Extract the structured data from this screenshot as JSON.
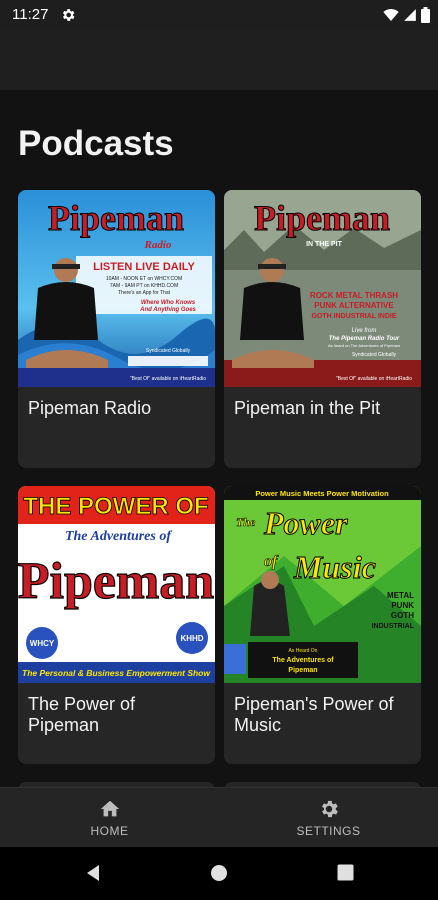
{
  "status_bar": {
    "time": "11:27",
    "icons": [
      "gear-icon",
      "wifi-icon",
      "signal-icon",
      "battery-icon"
    ]
  },
  "page": {
    "title": "Podcasts"
  },
  "podcasts": [
    {
      "title": "Pipeman Radio",
      "art": {
        "headline": "Pipeman",
        "sub": "Radio",
        "tagline": "LISTEN LIVE DAILY",
        "schedule_1": "10AM - NOON ET on WHCY.COM",
        "schedule_2": "7AM - 9AM PT on KHHD.COM",
        "schedule_3": "There's an App for That",
        "slogan_1": "Where Who Knows",
        "slogan_2": "And Anything Goes",
        "synd": "Syndicated Globally",
        "best": "\"Best Of\" available on iHeartRadio"
      }
    },
    {
      "title": "Pipeman in the Pit",
      "art": {
        "headline": "Pipeman",
        "sub": "IN THE PIT",
        "genres_1": "ROCK METAL THRASH",
        "genres_2": "PUNK ALTERNATIVE",
        "genres_3": "GOTH INDUSTRIAL INDIE",
        "live_1": "Live from",
        "live_2": "The Pipeman Radio Tour",
        "live_3": "As heard on The Adventures of Pipeman",
        "synd": "Syndicated Globally",
        "best": "\"Best Of\" available on iHeartRadio"
      }
    },
    {
      "title": "The Power of Pipeman",
      "title_lines": [
        "The Power of",
        "Pipeman"
      ],
      "art": {
        "top": "THE POWER OF",
        "mid": "The Adventures of",
        "headline": "Pipeman",
        "bottom": "The Personal & Business Empowerment Show",
        "badge_left": "WHCY",
        "badge_right": "KHHD"
      }
    },
    {
      "title": "Pipeman's Power of Music",
      "title_lines": [
        "Pipeman's Power of",
        "Music"
      ],
      "art": {
        "top": "Power Music Meets Power Motivation",
        "word_1": "The",
        "word_2": "Power",
        "word_3": "of",
        "word_4": "Music",
        "genre_1": "METAL",
        "genre_2": "PUNK",
        "genre_3": "GOTH",
        "genre_4": "INDUSTRIAL",
        "heard_1": "As Heard On",
        "heard_2": "The Adventures of",
        "heard_3": "Pipeman"
      }
    }
  ],
  "bottom_nav": {
    "items": [
      {
        "label": "HOME",
        "icon": "home-icon"
      },
      {
        "label": "SETTINGS",
        "icon": "gear-icon"
      }
    ]
  },
  "system_nav": {
    "buttons": [
      "back-icon",
      "home-circle-icon",
      "recents-icon"
    ]
  },
  "colors": {
    "background": "#121212",
    "card": "#262626",
    "app_bar": "#1f1f1f",
    "nav": "#252525"
  }
}
